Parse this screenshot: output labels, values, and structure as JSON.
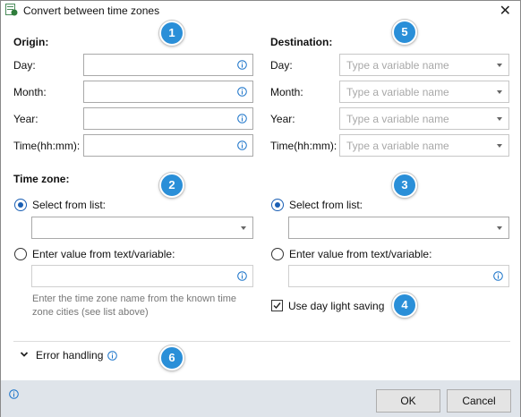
{
  "window": {
    "title": "Convert between time zones"
  },
  "origin": {
    "title": "Origin:",
    "fields": [
      {
        "label": "Day:",
        "value": ""
      },
      {
        "label": "Month:",
        "value": ""
      },
      {
        "label": "Year:",
        "value": ""
      },
      {
        "label": "Time(hh:mm):",
        "value": ""
      }
    ]
  },
  "destination": {
    "title": "Destination:",
    "fields": [
      {
        "label": "Day:",
        "placeholder": "Type a variable name"
      },
      {
        "label": "Month:",
        "placeholder": "Type a variable name"
      },
      {
        "label": "Year:",
        "placeholder": "Type a variable name"
      },
      {
        "label": "Time(hh:mm):",
        "placeholder": "Type a variable name"
      }
    ]
  },
  "timezone": {
    "title": "Time zone:",
    "left": {
      "select_label": "Select from list:",
      "select_value": "",
      "text_label": "Enter value from text/variable:",
      "text_value": "",
      "hint": "Enter the time zone name from the known time zone cities (see list above)"
    },
    "right": {
      "select_label": "Select from list:",
      "select_value": "",
      "text_label": "Enter value from text/variable:",
      "text_value": "",
      "daylight_label": "Use day light saving",
      "daylight_checked": true
    }
  },
  "error_handling": {
    "label": "Error handling"
  },
  "badges": [
    "1",
    "2",
    "3",
    "4",
    "5",
    "6"
  ],
  "buttons": {
    "ok": "OK",
    "cancel": "Cancel"
  },
  "colors": {
    "accent": "#2a8fd8",
    "footer": "#dfe4ea",
    "radio_checked": "#1a5fb4",
    "info_icon": "#1a73c9"
  }
}
